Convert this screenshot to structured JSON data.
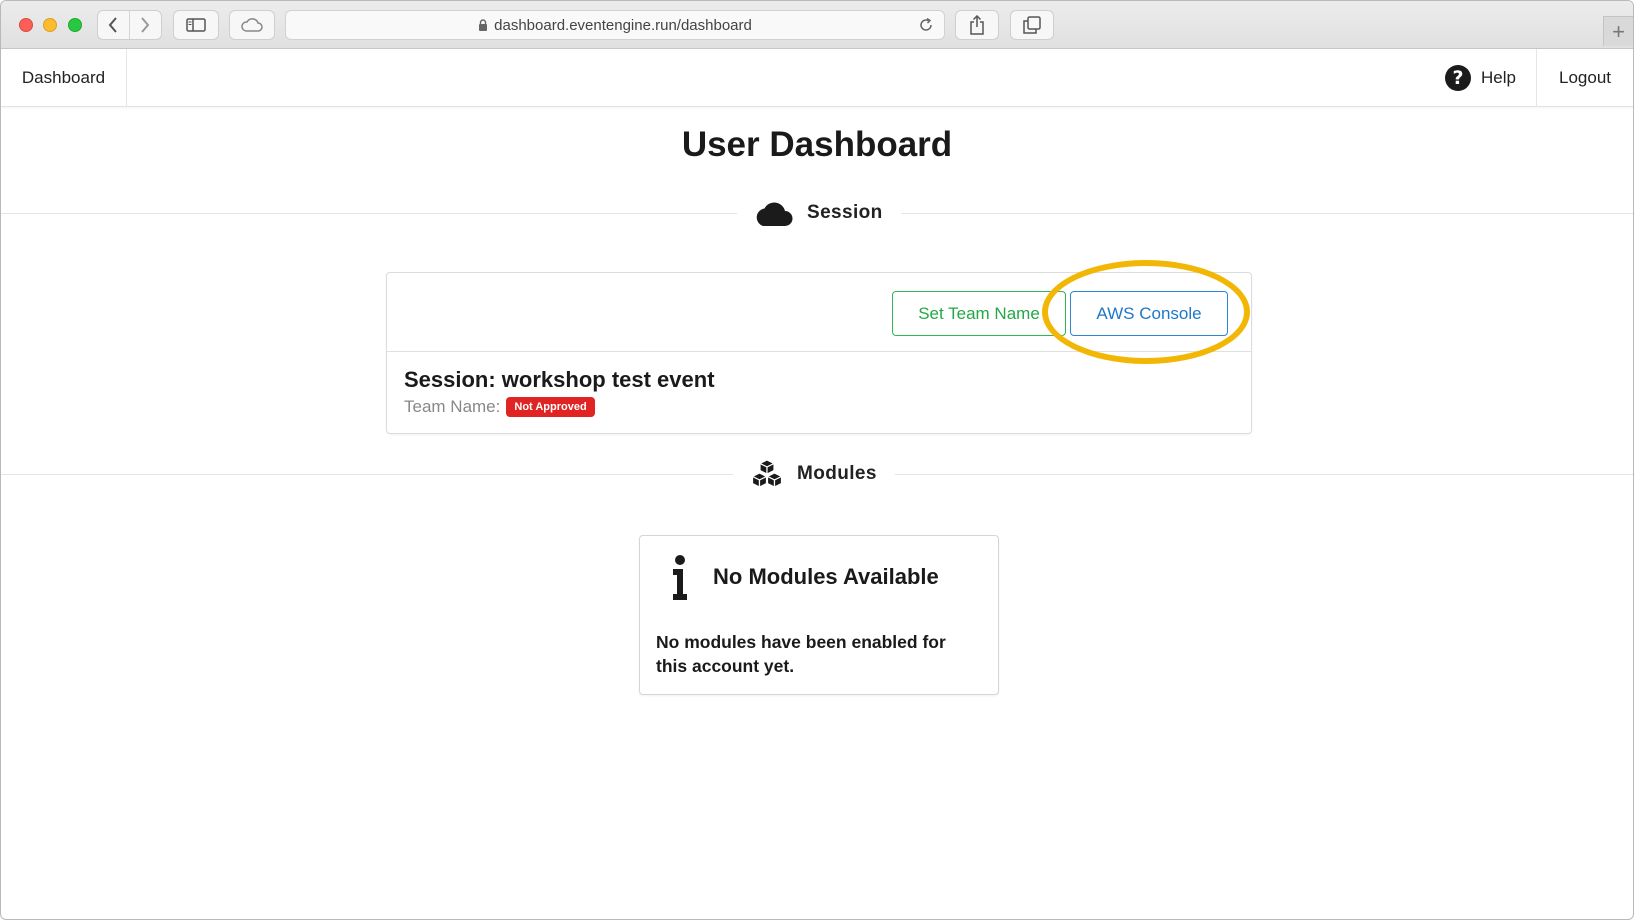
{
  "browser": {
    "url": "dashboard.eventengine.run/dashboard",
    "new_tab_label": "+"
  },
  "navbar": {
    "brand": "Dashboard",
    "help_label": "Help",
    "help_glyph": "?",
    "logout_label": "Logout"
  },
  "page": {
    "title": "User Dashboard"
  },
  "session_section": {
    "heading": "Session",
    "icon": "cloud-icon",
    "buttons": {
      "set_team_name": "Set Team Name",
      "aws_console": "AWS Console"
    },
    "session_title": "Session: workshop test event",
    "team_name_label": "Team Name:",
    "team_status_badge": "Not Approved"
  },
  "modules_section": {
    "heading": "Modules",
    "icon": "cubes-icon",
    "empty_card": {
      "title": "No Modules Available",
      "description": "No modules have been enabled for this account yet."
    }
  },
  "colors": {
    "success_outline": "#31b653",
    "primary_outline": "#2e86d1",
    "danger_badge": "#e02424",
    "highlight_ring": "#f2b705"
  }
}
